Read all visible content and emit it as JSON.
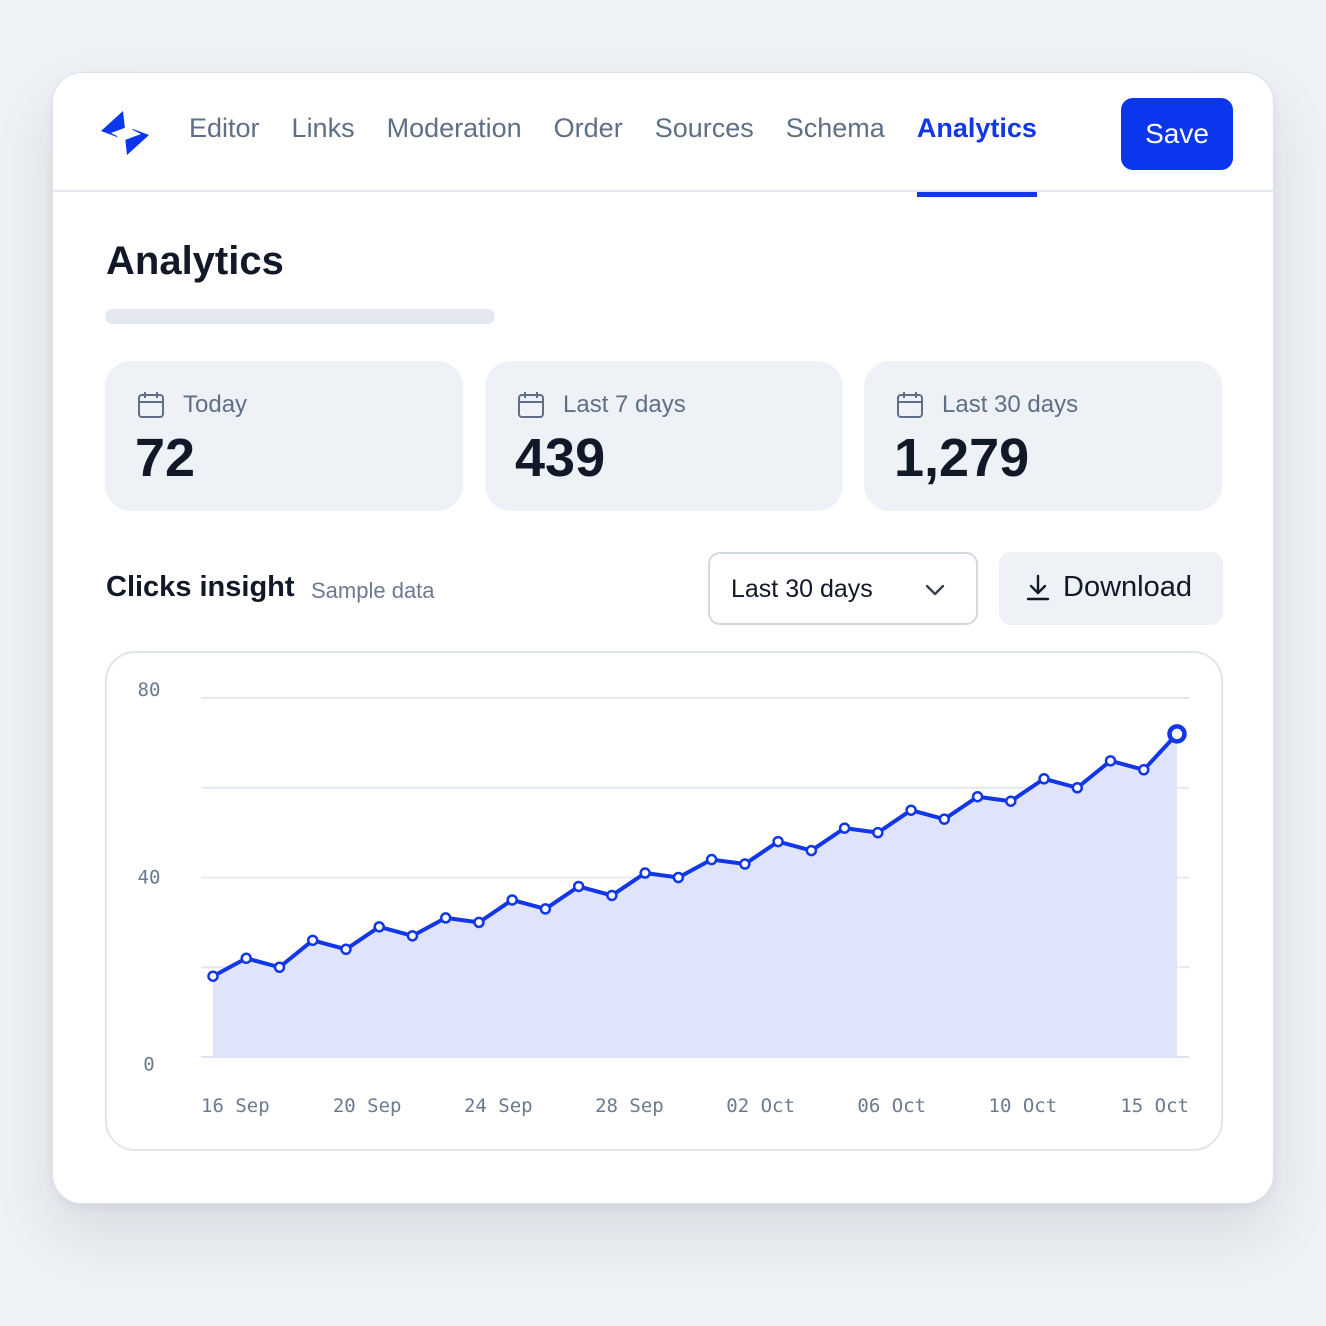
{
  "nav": {
    "tabs": [
      {
        "label": "Editor",
        "active": false
      },
      {
        "label": "Links",
        "active": false
      },
      {
        "label": "Moderation",
        "active": false
      },
      {
        "label": "Order",
        "active": false
      },
      {
        "label": "Sources",
        "active": false
      },
      {
        "label": "Schema",
        "active": false
      },
      {
        "label": "Analytics",
        "active": true
      }
    ],
    "save_label": "Save"
  },
  "page": {
    "title": "Analytics"
  },
  "stats": [
    {
      "label": "Today",
      "value": "72",
      "icon": "calendar-icon"
    },
    {
      "label": "Last 7 days",
      "value": "439",
      "icon": "calendar-icon"
    },
    {
      "label": "Last 30 days",
      "value": "1,279",
      "icon": "calendar-icon"
    }
  ],
  "insight": {
    "title": "Clicks insight",
    "subtitle": "Sample data",
    "range_value": "Last 30 days",
    "download_label": "Download"
  },
  "colors": {
    "accent": "#0a36ee",
    "line": "#1237e8",
    "area": "#dfe4fb"
  },
  "chart_data": {
    "type": "area",
    "x": [
      "16 Sep",
      "17 Sep",
      "18 Sep",
      "19 Sep",
      "20 Sep",
      "21 Sep",
      "22 Sep",
      "23 Sep",
      "24 Sep",
      "25 Sep",
      "26 Sep",
      "27 Sep",
      "28 Sep",
      "29 Sep",
      "30 Sep",
      "01 Oct",
      "02 Oct",
      "03 Oct",
      "04 Oct",
      "05 Oct",
      "06 Oct",
      "07 Oct",
      "08 Oct",
      "09 Oct",
      "10 Oct",
      "11 Oct",
      "12 Oct",
      "13 Oct",
      "14 Oct",
      "15 Oct"
    ],
    "series": [
      {
        "values": [
          18,
          22,
          20,
          26,
          24,
          29,
          27,
          31,
          30,
          35,
          33,
          38,
          36,
          41,
          40,
          44,
          43,
          48,
          46,
          51,
          50,
          55,
          53,
          58,
          57,
          62,
          60,
          66,
          64,
          72
        ]
      }
    ],
    "x_tick_labels": [
      "16 Sep",
      "20 Sep",
      "24 Sep",
      "28 Sep",
      "02 Oct",
      "06 Oct",
      "10 Oct",
      "15 Oct"
    ],
    "y_tick_labels": [
      "0",
      "40",
      "80"
    ],
    "ylim": [
      0,
      80
    ],
    "grid": true,
    "legend": "none"
  }
}
